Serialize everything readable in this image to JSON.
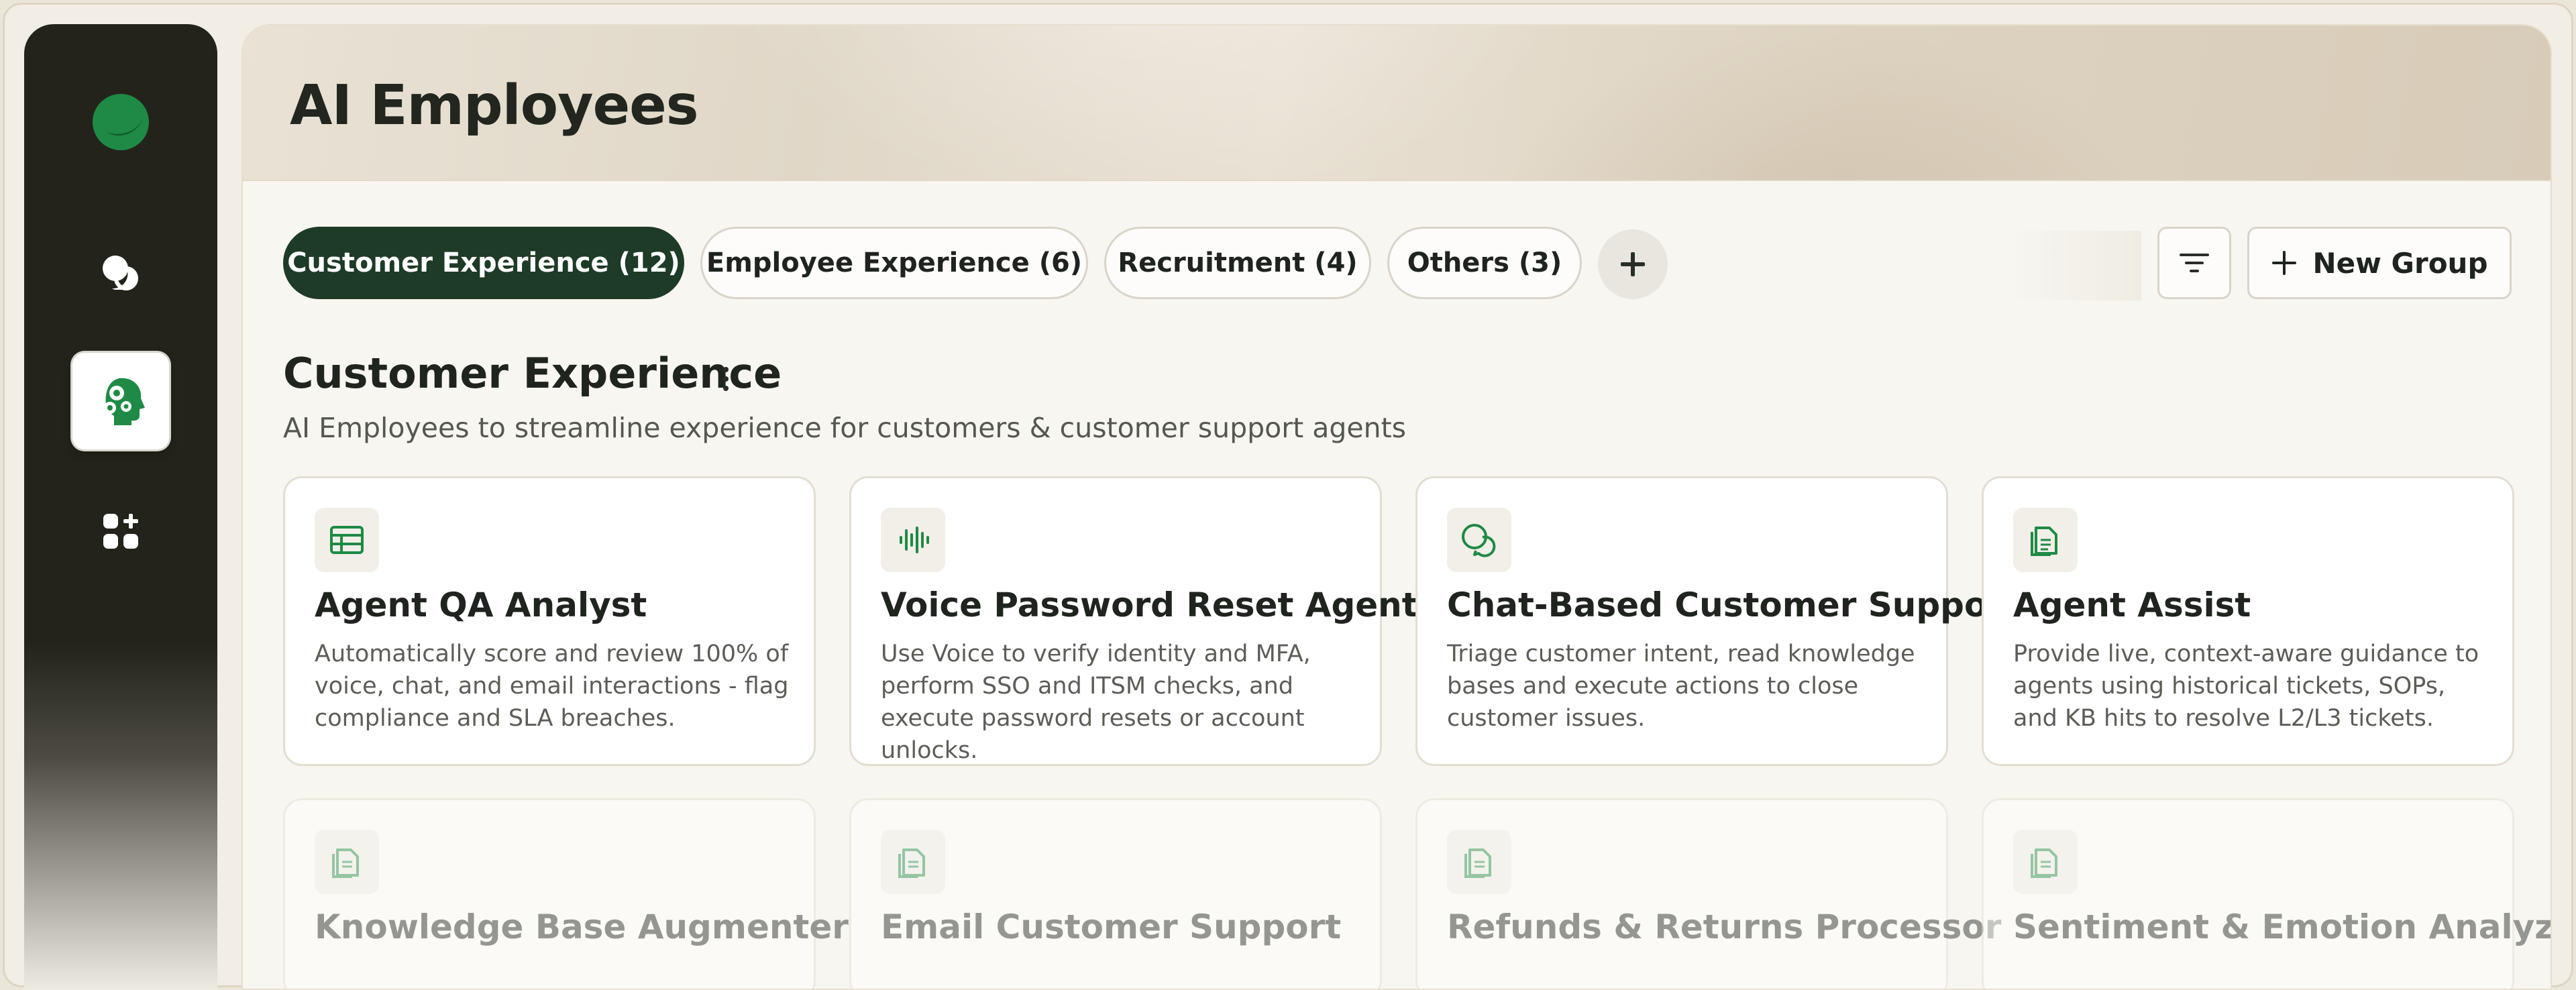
{
  "page": {
    "title": "AI Employees"
  },
  "sidebar": {
    "items": [
      {
        "name": "logo",
        "icon": "green-orb-logo-icon"
      },
      {
        "name": "chats",
        "icon": "chat-bubbles-icon"
      },
      {
        "name": "ai-employees",
        "icon": "ai-head-gears-icon",
        "active": true
      },
      {
        "name": "apps",
        "icon": "apps-grid-plus-icon"
      }
    ]
  },
  "tabs": [
    {
      "label": "Customer Experience (12)",
      "active": true
    },
    {
      "label": "Employee Experience (6)",
      "active": false
    },
    {
      "label": "Recruitment (4)",
      "active": false
    },
    {
      "label": "Others (3)",
      "active": false
    }
  ],
  "toolbar": {
    "new_group_label": "New Group",
    "add_icon": "plus-icon",
    "filter_icon": "filter-lines-icon"
  },
  "section": {
    "title": "Customer Experience",
    "subtitle": "AI Employees to streamline experience for customers & customer support agents"
  },
  "cards": [
    {
      "title": "Agent QA Analyst",
      "description": "Automatically score and review 100% of voice, chat, and email interactions - flag compliance and SLA breaches.",
      "icon": "table-icon"
    },
    {
      "title": "Voice Password Reset Agent",
      "description": "Use Voice to verify identity and MFA, perform SSO and ITSM checks, and execute password resets or account unlocks.",
      "icon": "audio-waveform-icon"
    },
    {
      "title": "Chat-Based Customer Support",
      "description": "Triage customer intent, read knowledge bases and execute actions to close customer issues.",
      "icon": "chat-bubbles-icon"
    },
    {
      "title": "Agent Assist",
      "description": "Provide live, context-aware guidance to agents using historical tickets, SOPs, and KB hits to resolve L2/L3 tickets.",
      "icon": "documents-icon"
    },
    {
      "title": "Knowledge Base Augmenter",
      "description": "",
      "icon": "documents-icon"
    },
    {
      "title": "Email Customer Support",
      "description": "",
      "icon": "documents-icon"
    },
    {
      "title": "Refunds & Returns Processor",
      "description": "",
      "icon": "documents-icon"
    },
    {
      "title": "Sentiment & Emotion Analyzer",
      "description": "",
      "icon": "documents-icon"
    }
  ],
  "colors": {
    "accent": "#1d3b27",
    "brand_green": "#1e8a45",
    "sidebar": "#23231b"
  }
}
